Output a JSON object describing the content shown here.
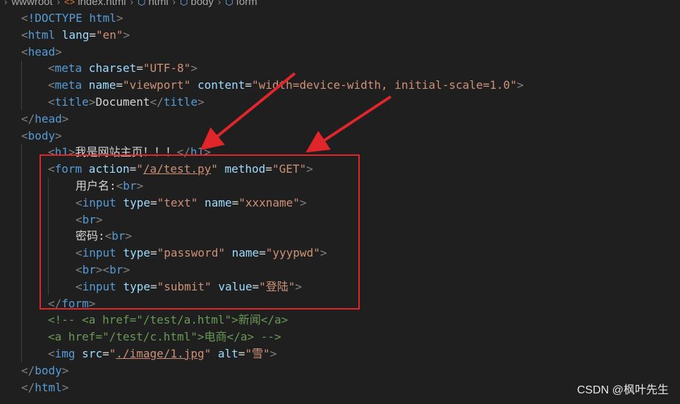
{
  "breadcrumb": [
    {
      "label": "wwwroot",
      "icon": "none"
    },
    {
      "label": "index.html",
      "icon": "html-file-icon"
    },
    {
      "label": "html",
      "icon": "element-cube-icon"
    },
    {
      "label": "body",
      "icon": "element-cube-icon"
    },
    {
      "label": "form",
      "icon": "element-cube-icon"
    }
  ],
  "code": {
    "doctype": "!DOCTYPE",
    "doctype_html": " html",
    "html_tag": "html",
    "lang_attr": " lang",
    "lang_val": "\"en\"",
    "head_tag": "head",
    "meta": "meta",
    "charset_attr": " charset",
    "charset_val": "\"UTF-8\"",
    "name_attr": " name",
    "viewport_val": "\"viewport\"",
    "content_attr": " content",
    "content_val": "\"width=device-width, initial-scale=1.0\"",
    "title_tag": "title",
    "title_text": "Document",
    "body_tag": "body",
    "h1_tag": "h1",
    "h1_text": "我是网站主页！！！",
    "form_tag": "form",
    "action_attr": " action",
    "action_val_path": "/a/test.py",
    "method_attr": " method",
    "method_val": "\"GET\"",
    "username_label": "用户名:",
    "br_tag": "br",
    "input_tag": "input",
    "type_attr": " type",
    "type_text": "\"text\"",
    "name_val_user": "\"xxxname\"",
    "password_label": "密码:",
    "type_password": "\"password\"",
    "name_val_pwd": "\"yyypwd\"",
    "type_submit": "\"submit\"",
    "value_attr": " value",
    "value_submit": "\"登陆\"",
    "comment_line1": "<!-- <a href=\"/test/a.html\">新闻</a>",
    "comment_line2": "<a href=\"/test/c.html\">电商</a> -->",
    "img_tag": "img",
    "src_attr": " src",
    "src_path": "./image/1.jpg",
    "alt_attr": " alt",
    "alt_val": "\"雪\""
  },
  "watermark": "CSDN @枫叶先生",
  "colors": {
    "background": "#1f1f1f",
    "tag": "#569cd6",
    "attribute": "#9cdcfe",
    "string": "#ce9178",
    "comment": "#6a9955",
    "annotation": "#e0252b"
  }
}
